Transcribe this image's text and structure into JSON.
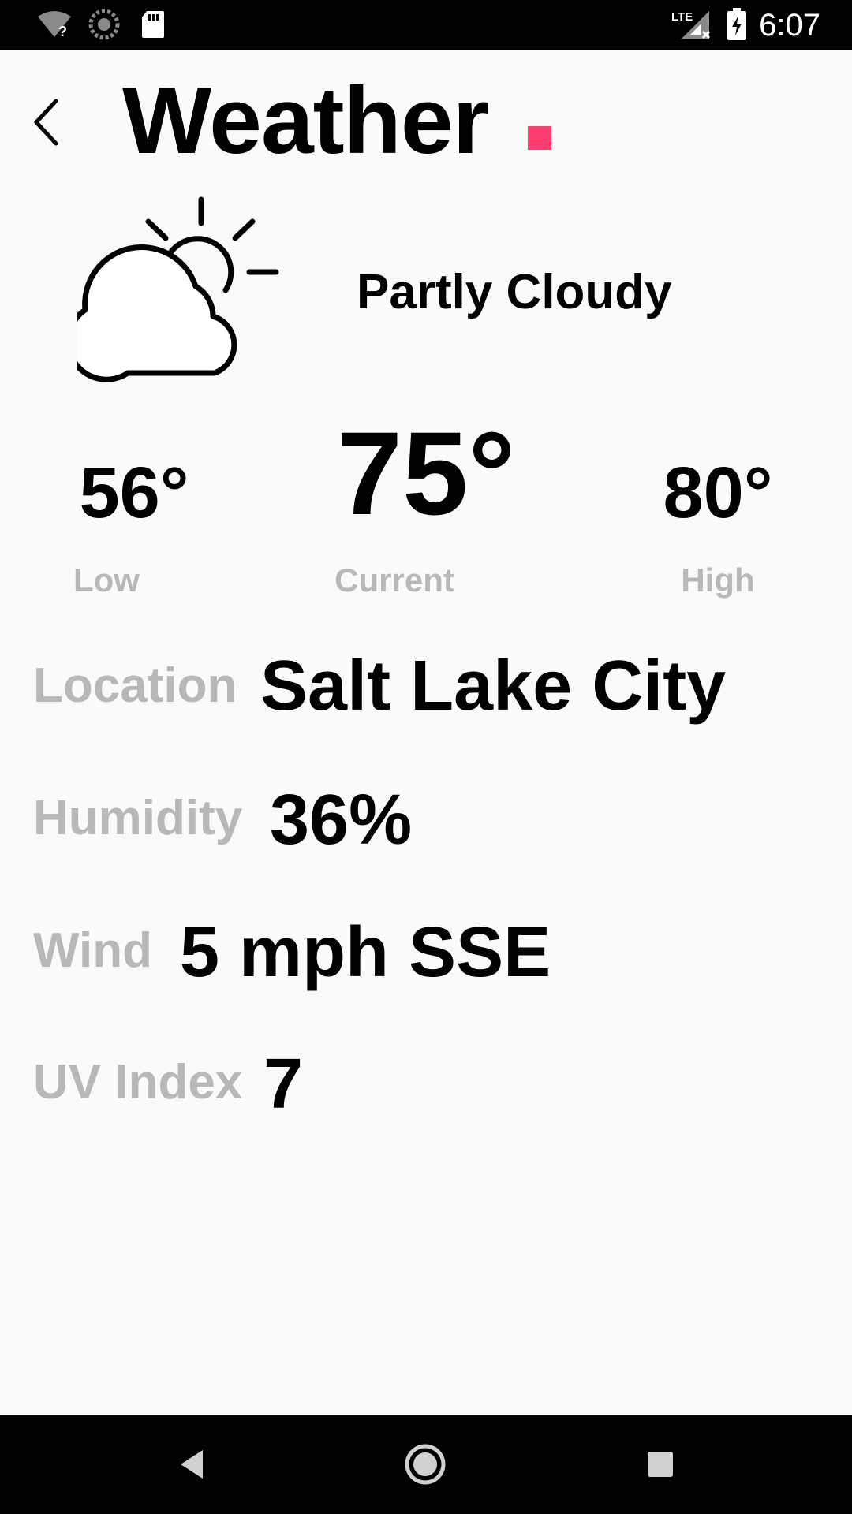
{
  "status_bar": {
    "time": "6:07",
    "icons": [
      "wifi-unknown-icon",
      "sync-icon",
      "sd-card-icon",
      "lte-no-signal-icon",
      "battery-charging-icon"
    ]
  },
  "header": {
    "title": "Weather",
    "back_icon": "chevron-left-icon",
    "accent_color": "#ff3d6e"
  },
  "weather": {
    "icon": "partly-cloudy-icon",
    "condition": "Partly Cloudy",
    "low": {
      "value": "56°",
      "label": "Low"
    },
    "current": {
      "value": "75°",
      "label": "Current"
    },
    "high": {
      "value": "80°",
      "label": "High"
    }
  },
  "details": {
    "location": {
      "label": "Location",
      "value": "Salt Lake City"
    },
    "humidity": {
      "label": "Humidity",
      "value": "36%"
    },
    "wind": {
      "label": "Wind",
      "value": "5 mph SSE"
    },
    "uv_index": {
      "label": "UV Index",
      "value": "7"
    }
  },
  "colors": {
    "label_gray": "#b8b8b8",
    "background": "#fafafa"
  },
  "nav_bar": {
    "icons": [
      "nav-back-icon",
      "nav-home-icon",
      "nav-recents-icon"
    ]
  }
}
